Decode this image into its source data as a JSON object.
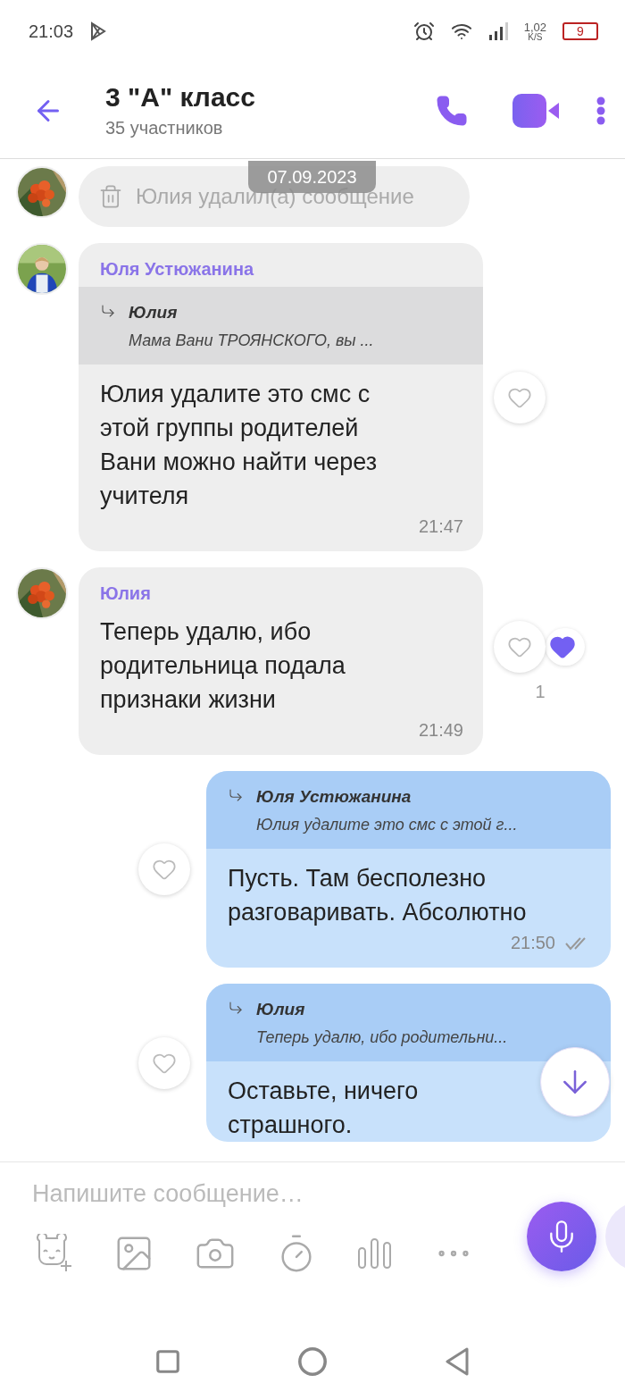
{
  "status_bar": {
    "time": "21:03",
    "net_speed": "1,02",
    "net_unit": "K/S",
    "battery": "9"
  },
  "header": {
    "title": "3 \"А\" класс",
    "subtitle": "35 участников"
  },
  "date_badge": "07.09.2023",
  "messages": [
    {
      "kind": "deleted",
      "text": "Юлия удалил(а) сообщение"
    },
    {
      "kind": "incoming",
      "sender": "Юля Устюжанина",
      "reply": {
        "author": "Юлия",
        "text": "Мама Вани ТРОЯНСКОГО, вы ..."
      },
      "text": "Юлия удалите это смс с\nэтой группы родителей\nВани можно найти через\nучителя",
      "time": "21:47",
      "liked": false
    },
    {
      "kind": "incoming",
      "sender": "Юлия",
      "text": "Теперь удалю, ибо\nродительница подала\nпризнаки жизни",
      "time": "21:49",
      "liked": false,
      "reaction_count": "1"
    },
    {
      "kind": "outgoing",
      "reply": {
        "author": "Юля Устюжанина",
        "text": "Юлия удалите это смс с этой г..."
      },
      "text": "Пусть. Там бесполезно\nразговаривать. Абсолютно",
      "time": "21:50",
      "read": true,
      "liked": false
    },
    {
      "kind": "outgoing",
      "reply": {
        "author": "Юлия",
        "text": "Теперь удалю, ибо родительни..."
      },
      "text": "Оставьте, ничего\nстрашного.",
      "liked": false
    }
  ],
  "composer": {
    "placeholder": "Напишите сообщение…"
  }
}
